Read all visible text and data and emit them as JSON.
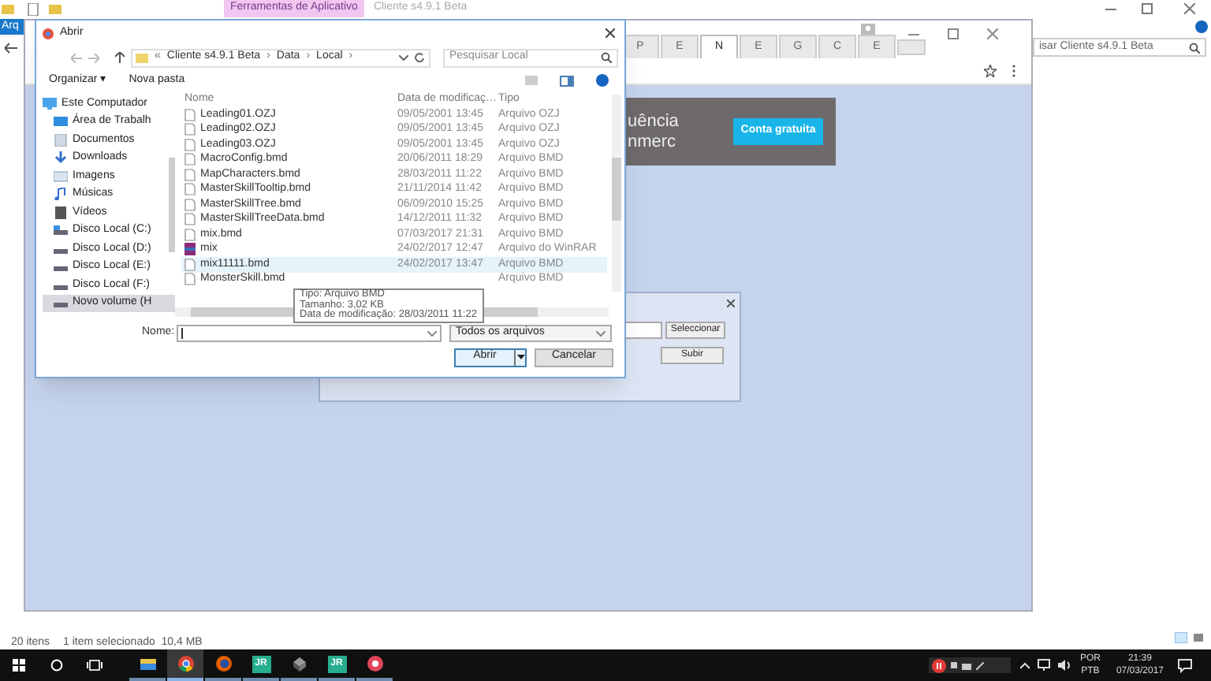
{
  "explorer": {
    "ribbon_tab": "Ferramentas de Aplicativo",
    "title": "Cliente s4.9.1 Beta",
    "file_tab": "Arq",
    "search_placeholder": "isar Cliente s4.9.1 Beta",
    "item_count": "20 itens",
    "selection": "1 item selecionado  10,4 MB"
  },
  "browser": {
    "tabs": [
      {
        "label": "P",
        "selected": false
      },
      {
        "label": "E",
        "selected": false
      },
      {
        "label": "N",
        "selected": true
      },
      {
        "label": "E",
        "selected": false
      },
      {
        "label": "G",
        "selected": false
      },
      {
        "label": "C",
        "selected": false
      },
      {
        "label": "E",
        "selected": false
      }
    ],
    "ad": {
      "line_1": "uência",
      "line_2": "nmerc",
      "button": "Conta gratuita"
    },
    "upload_dialog": {
      "select_button": "Seleccionar",
      "upload_button": "Subir"
    }
  },
  "open_dialog": {
    "title": "Abrir",
    "breadcrumb_prefix": "«",
    "breadcrumb": [
      {
        "label": "Cliente s4.9.1 Beta",
        "separator": "›"
      },
      {
        "label": "Data",
        "separator": "›"
      },
      {
        "label": "Local",
        "separator": "›"
      }
    ],
    "search_placeholder": "Pesquisar Local",
    "organize": "Organizar ▾",
    "new_folder": "Nova pasta",
    "nav": [
      {
        "label": "Este Computador",
        "kind": "computer",
        "selected": false
      },
      {
        "label": "Área de Trabalh",
        "kind": "desktop",
        "selected": false
      },
      {
        "label": "Documentos",
        "kind": "documents",
        "selected": false
      },
      {
        "label": "Downloads",
        "kind": "downloads",
        "selected": false
      },
      {
        "label": "Imagens",
        "kind": "pictures",
        "selected": false
      },
      {
        "label": "Músicas",
        "kind": "music",
        "selected": false
      },
      {
        "label": "Vídeos",
        "kind": "videos",
        "selected": false
      },
      {
        "label": "Disco Local (C:)",
        "kind": "system-drive",
        "selected": false
      },
      {
        "label": "Disco Local (D:)",
        "kind": "drive",
        "selected": false
      },
      {
        "label": "Disco Local (E:)",
        "kind": "drive",
        "selected": false
      },
      {
        "label": "Disco Local (F:)",
        "kind": "drive",
        "selected": false
      },
      {
        "label": "Novo volume (H",
        "kind": "drive",
        "selected": true
      }
    ],
    "columns": [
      "Nome",
      "Data de modificaç…",
      "Tipo"
    ],
    "files": [
      {
        "name": "Leading01.OZJ",
        "date": "09/05/2001 13:45",
        "type": "Arquivo OZJ",
        "kind": "file",
        "hovered": false
      },
      {
        "name": "Leading02.OZJ",
        "date": "09/05/2001 13:45",
        "type": "Arquivo OZJ",
        "kind": "file",
        "hovered": false
      },
      {
        "name": "Leading03.OZJ",
        "date": "09/05/2001 13:45",
        "type": "Arquivo OZJ",
        "kind": "file",
        "hovered": false
      },
      {
        "name": "MacroConfig.bmd",
        "date": "20/06/2011 18:29",
        "type": "Arquivo BMD",
        "kind": "file",
        "hovered": false
      },
      {
        "name": "MapCharacters.bmd",
        "date": "28/03/2011 11:22",
        "type": "Arquivo BMD",
        "kind": "file",
        "hovered": false
      },
      {
        "name": "MasterSkillTooltip.bmd",
        "date": "21/11/2014 11:42",
        "type": "Arquivo BMD",
        "kind": "file",
        "hovered": false
      },
      {
        "name": "MasterSkillTree.bmd",
        "date": "06/09/2010 15:25",
        "type": "Arquivo BMD",
        "kind": "file",
        "hovered": false
      },
      {
        "name": "MasterSkillTreeData.bmd",
        "date": "14/12/2011 11:32",
        "type": "Arquivo BMD",
        "kind": "file",
        "hovered": false
      },
      {
        "name": "mix.bmd",
        "date": "07/03/2017 21:31",
        "type": "Arquivo BMD",
        "kind": "file",
        "hovered": false
      },
      {
        "name": "mix",
        "date": "24/02/2017 12:47",
        "type": "Arquivo do WinRAR",
        "kind": "archive",
        "hovered": false
      },
      {
        "name": "mix11111.bmd",
        "date": "24/02/2017 13:47",
        "type": "Arquivo BMD",
        "kind": "file",
        "hovered": true
      },
      {
        "name": "MonsterSkill.bmd",
        "type": "Arquivo BMD",
        "kind": "file",
        "hovered": false
      }
    ],
    "tooltip": [
      "Tipo: Arquivo BMD",
      "Tamanho: 3,02 KB",
      "Data de modificação: 28/03/2011 11:22"
    ],
    "name_label": "Nome:",
    "filter": "Todos os arquivos",
    "open_button": "Abrir",
    "cancel_button": "Cancelar"
  },
  "taskbar": {
    "apps": [
      {
        "kind": "folder",
        "active": false
      },
      {
        "kind": "chrome",
        "active": true
      },
      {
        "kind": "firefox",
        "active": false
      },
      {
        "kind": "jr",
        "label": "JR",
        "active": false
      },
      {
        "kind": "box",
        "active": false
      },
      {
        "kind": "jr",
        "label": "JR",
        "active": false
      },
      {
        "kind": "red",
        "active": false
      }
    ],
    "language": "POR",
    "layout": "PTB",
    "time": "21:39",
    "date": "07/03/2017"
  }
}
